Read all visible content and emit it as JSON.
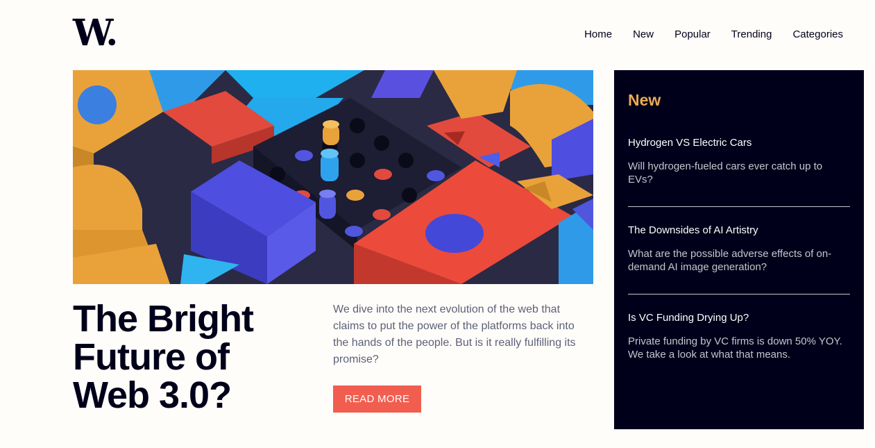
{
  "header": {
    "logo_text": "W.",
    "nav": [
      "Home",
      "New",
      "Popular",
      "Trending",
      "Categories"
    ]
  },
  "hero": {
    "image_icon": "abstract-3d-blocks-image"
  },
  "main": {
    "headline": "The Bright Future of Web 3.0?",
    "intro": "We dive into the next evolution of the web that claims to put the power of the platforms back into the hands of the people. But is it really fulfilling its promise?",
    "cta_label": "READ MORE"
  },
  "sidebar": {
    "heading": "New",
    "items": [
      {
        "title": "Hydrogen VS Electric Cars",
        "desc": "Will hydrogen-fueled cars ever catch up to EVs?"
      },
      {
        "title": "The Downsides of AI Artistry",
        "desc": "What are the possible adverse effects of on-demand AI image generation?"
      },
      {
        "title": "Is VC Funding Drying Up?",
        "desc": "Private funding by VC firms is down 50% YOY. We take a look at what that means."
      }
    ]
  },
  "colors": {
    "background": "#fffdf9",
    "dark": "#00001a",
    "accent_orange": "#e9ab53",
    "accent_red": "#f15e50",
    "body_text": "#5d5f79"
  }
}
